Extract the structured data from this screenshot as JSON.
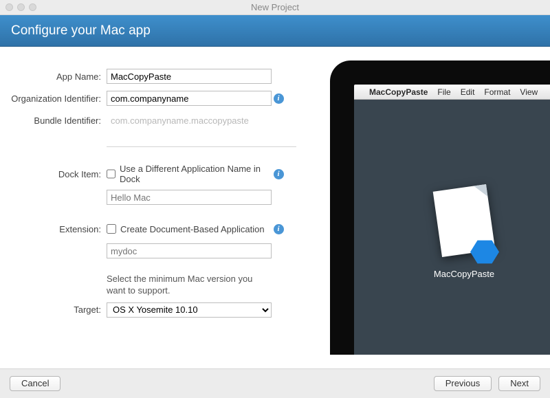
{
  "window": {
    "title": "New Project"
  },
  "banner": {
    "heading": "Configure your Mac app"
  },
  "form": {
    "appName": {
      "label": "App Name:",
      "value": "MacCopyPaste"
    },
    "orgId": {
      "label": "Organization Identifier:",
      "value": "com.companyname"
    },
    "bundleId": {
      "label": "Bundle Identifier:",
      "value": "com.companyname.maccopypaste"
    },
    "dockItem": {
      "label": "Dock Item:",
      "check": "Use a Different Application Name in Dock",
      "placeholder": "Hello Mac"
    },
    "extension": {
      "label": "Extension:",
      "check": "Create Document-Based Application",
      "placeholder": "mydoc"
    },
    "targetHelp": "Select the minimum Mac version you want to support.",
    "target": {
      "label": "Target:",
      "value": "OS X Yosemite 10.10"
    }
  },
  "preview": {
    "menu": {
      "appName": "MacCopyPaste",
      "items": [
        "File",
        "Edit",
        "Format",
        "View"
      ]
    },
    "iconLabel": "MacCopyPaste"
  },
  "buttons": {
    "cancel": "Cancel",
    "previous": "Previous",
    "next": "Next"
  }
}
